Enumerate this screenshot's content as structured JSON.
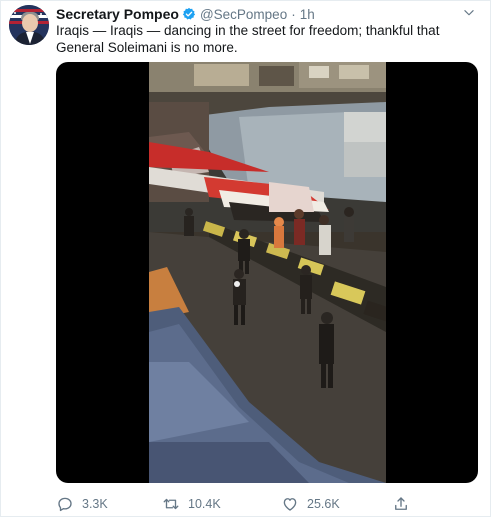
{
  "author": {
    "display_name": "Secretary Pompeo",
    "handle": "@SecPompeo",
    "separator": "·",
    "time": "1h"
  },
  "tweet": {
    "text_line1": "Iraqis — Iraqis — dancing in the street for freedom; thankful that",
    "text_line2": "General Soleimani is no more."
  },
  "actions": {
    "replies": "3.3K",
    "retweets": "10.4K",
    "likes": "25.6K"
  },
  "colors": {
    "verified": "#1da1f2",
    "secondary_text": "#657786",
    "primary_text": "#14171a"
  },
  "icons": [
    "verified-badge-icon",
    "chevron-down-icon",
    "reply-icon",
    "retweet-icon",
    "like-icon",
    "share-icon"
  ]
}
